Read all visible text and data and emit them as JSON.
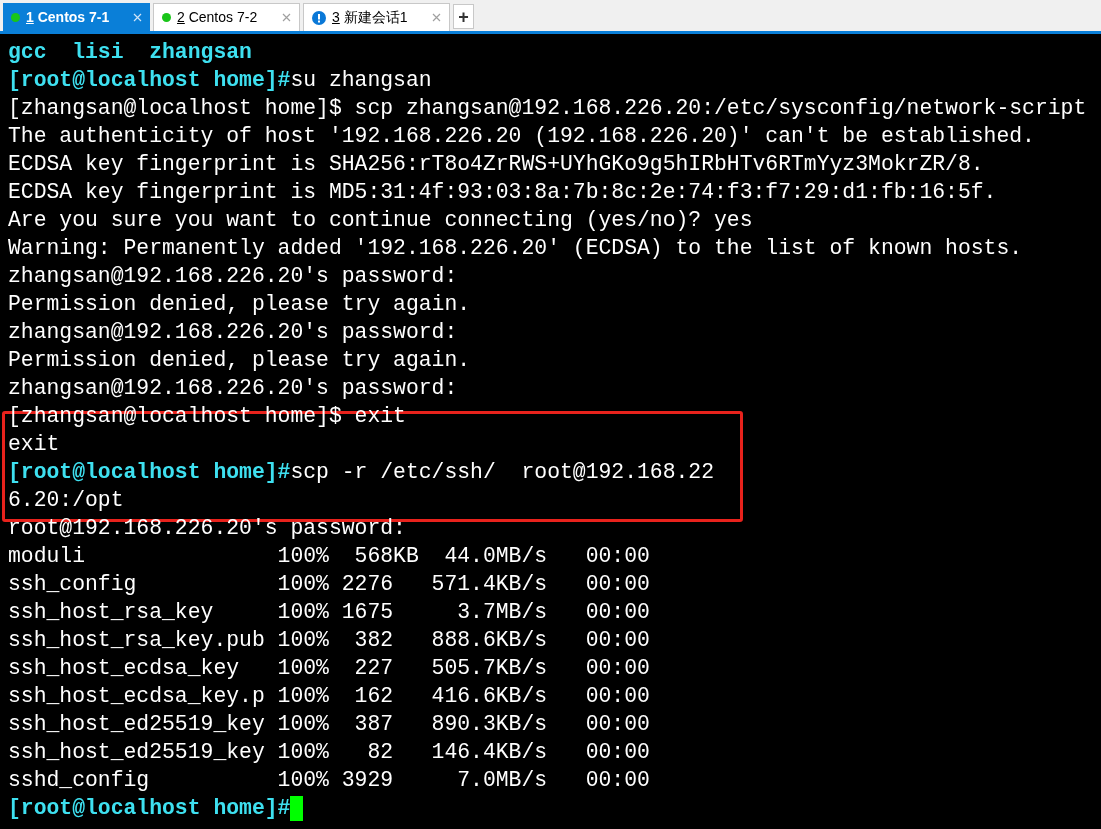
{
  "tabs": [
    {
      "number": "1",
      "label": "Centos 7-1",
      "selected": true,
      "kind": "connected",
      "color": "#19c519"
    },
    {
      "number": "2",
      "label": "Centos 7-2",
      "selected": false,
      "kind": "connected",
      "color": "#19c519"
    },
    {
      "number": "3",
      "label": "新建会话1",
      "selected": false,
      "kind": "alert",
      "color": "#0a78d7"
    }
  ],
  "new_tab_button": "+",
  "terminal": {
    "lines": [
      [
        {
          "kind": "dir",
          "text": "gcc  lisi  zhangsan"
        }
      ],
      [
        {
          "kind": "prompt",
          "text": "[root@localhost home]#"
        },
        {
          "kind": "plain",
          "text": "su zhangsan"
        }
      ],
      [
        {
          "kind": "plain",
          "text": "[zhangsan@localhost home]$ scp zhangsan@192.168.226.20:/etc/sysconfig/network-script"
        }
      ],
      [
        {
          "kind": "plain",
          "text": "The authenticity of host '192.168.226.20 (192.168.226.20)' can't be established."
        }
      ],
      [
        {
          "kind": "plain",
          "text": "ECDSA key fingerprint is SHA256:rT8o4ZrRWS+UYhGKo9g5hIRbHTv6RTmYyz3MokrZR/8."
        }
      ],
      [
        {
          "kind": "plain",
          "text": "ECDSA key fingerprint is MD5:31:4f:93:03:8a:7b:8c:2e:74:f3:f7:29:d1:fb:16:5f."
        }
      ],
      [
        {
          "kind": "plain",
          "text": "Are you sure you want to continue connecting (yes/no)? yes"
        }
      ],
      [
        {
          "kind": "plain",
          "text": "Warning: Permanently added '192.168.226.20' (ECDSA) to the list of known hosts."
        }
      ],
      [
        {
          "kind": "plain",
          "text": "zhangsan@192.168.226.20's password:"
        }
      ],
      [
        {
          "kind": "plain",
          "text": "Permission denied, please try again."
        }
      ],
      [
        {
          "kind": "plain",
          "text": "zhangsan@192.168.226.20's password:"
        }
      ],
      [
        {
          "kind": "plain",
          "text": "Permission denied, please try again."
        }
      ],
      [
        {
          "kind": "plain",
          "text": "zhangsan@192.168.226.20's password:"
        }
      ],
      [
        {
          "kind": "plain",
          "text": "[zhangsan@localhost home]$ exit"
        }
      ],
      [
        {
          "kind": "plain",
          "text": "exit"
        }
      ],
      [
        {
          "kind": "prompt",
          "text": "[root@localhost home]#"
        },
        {
          "kind": "plain",
          "text": "scp -r /etc/ssh/  root@192.168.22"
        }
      ],
      [
        {
          "kind": "plain",
          "text": "6.20:/opt"
        }
      ],
      [
        {
          "kind": "plain",
          "text": "root@192.168.226.20's password:"
        }
      ],
      [
        {
          "kind": "plain",
          "text": "moduli               100%  568KB  44.0MB/s   00:00"
        }
      ],
      [
        {
          "kind": "plain",
          "text": "ssh_config           100% 2276   571.4KB/s   00:00"
        }
      ],
      [
        {
          "kind": "plain",
          "text": "ssh_host_rsa_key     100% 1675     3.7MB/s   00:00"
        }
      ],
      [
        {
          "kind": "plain",
          "text": "ssh_host_rsa_key.pub 100%  382   888.6KB/s   00:00"
        }
      ],
      [
        {
          "kind": "plain",
          "text": "ssh_host_ecdsa_key   100%  227   505.7KB/s   00:00"
        }
      ],
      [
        {
          "kind": "plain",
          "text": "ssh_host_ecdsa_key.p 100%  162   416.6KB/s   00:00"
        }
      ],
      [
        {
          "kind": "plain",
          "text": "ssh_host_ed25519_key 100%  387   890.3KB/s   00:00"
        }
      ],
      [
        {
          "kind": "plain",
          "text": "ssh_host_ed25519_key 100%   82   146.4KB/s   00:00"
        }
      ],
      [
        {
          "kind": "plain",
          "text": "sshd_config          100% 3929     7.0MB/s   00:00"
        }
      ],
      [
        {
          "kind": "prompt",
          "text": "[root@localhost home]#"
        },
        {
          "kind": "cursor"
        }
      ]
    ]
  }
}
